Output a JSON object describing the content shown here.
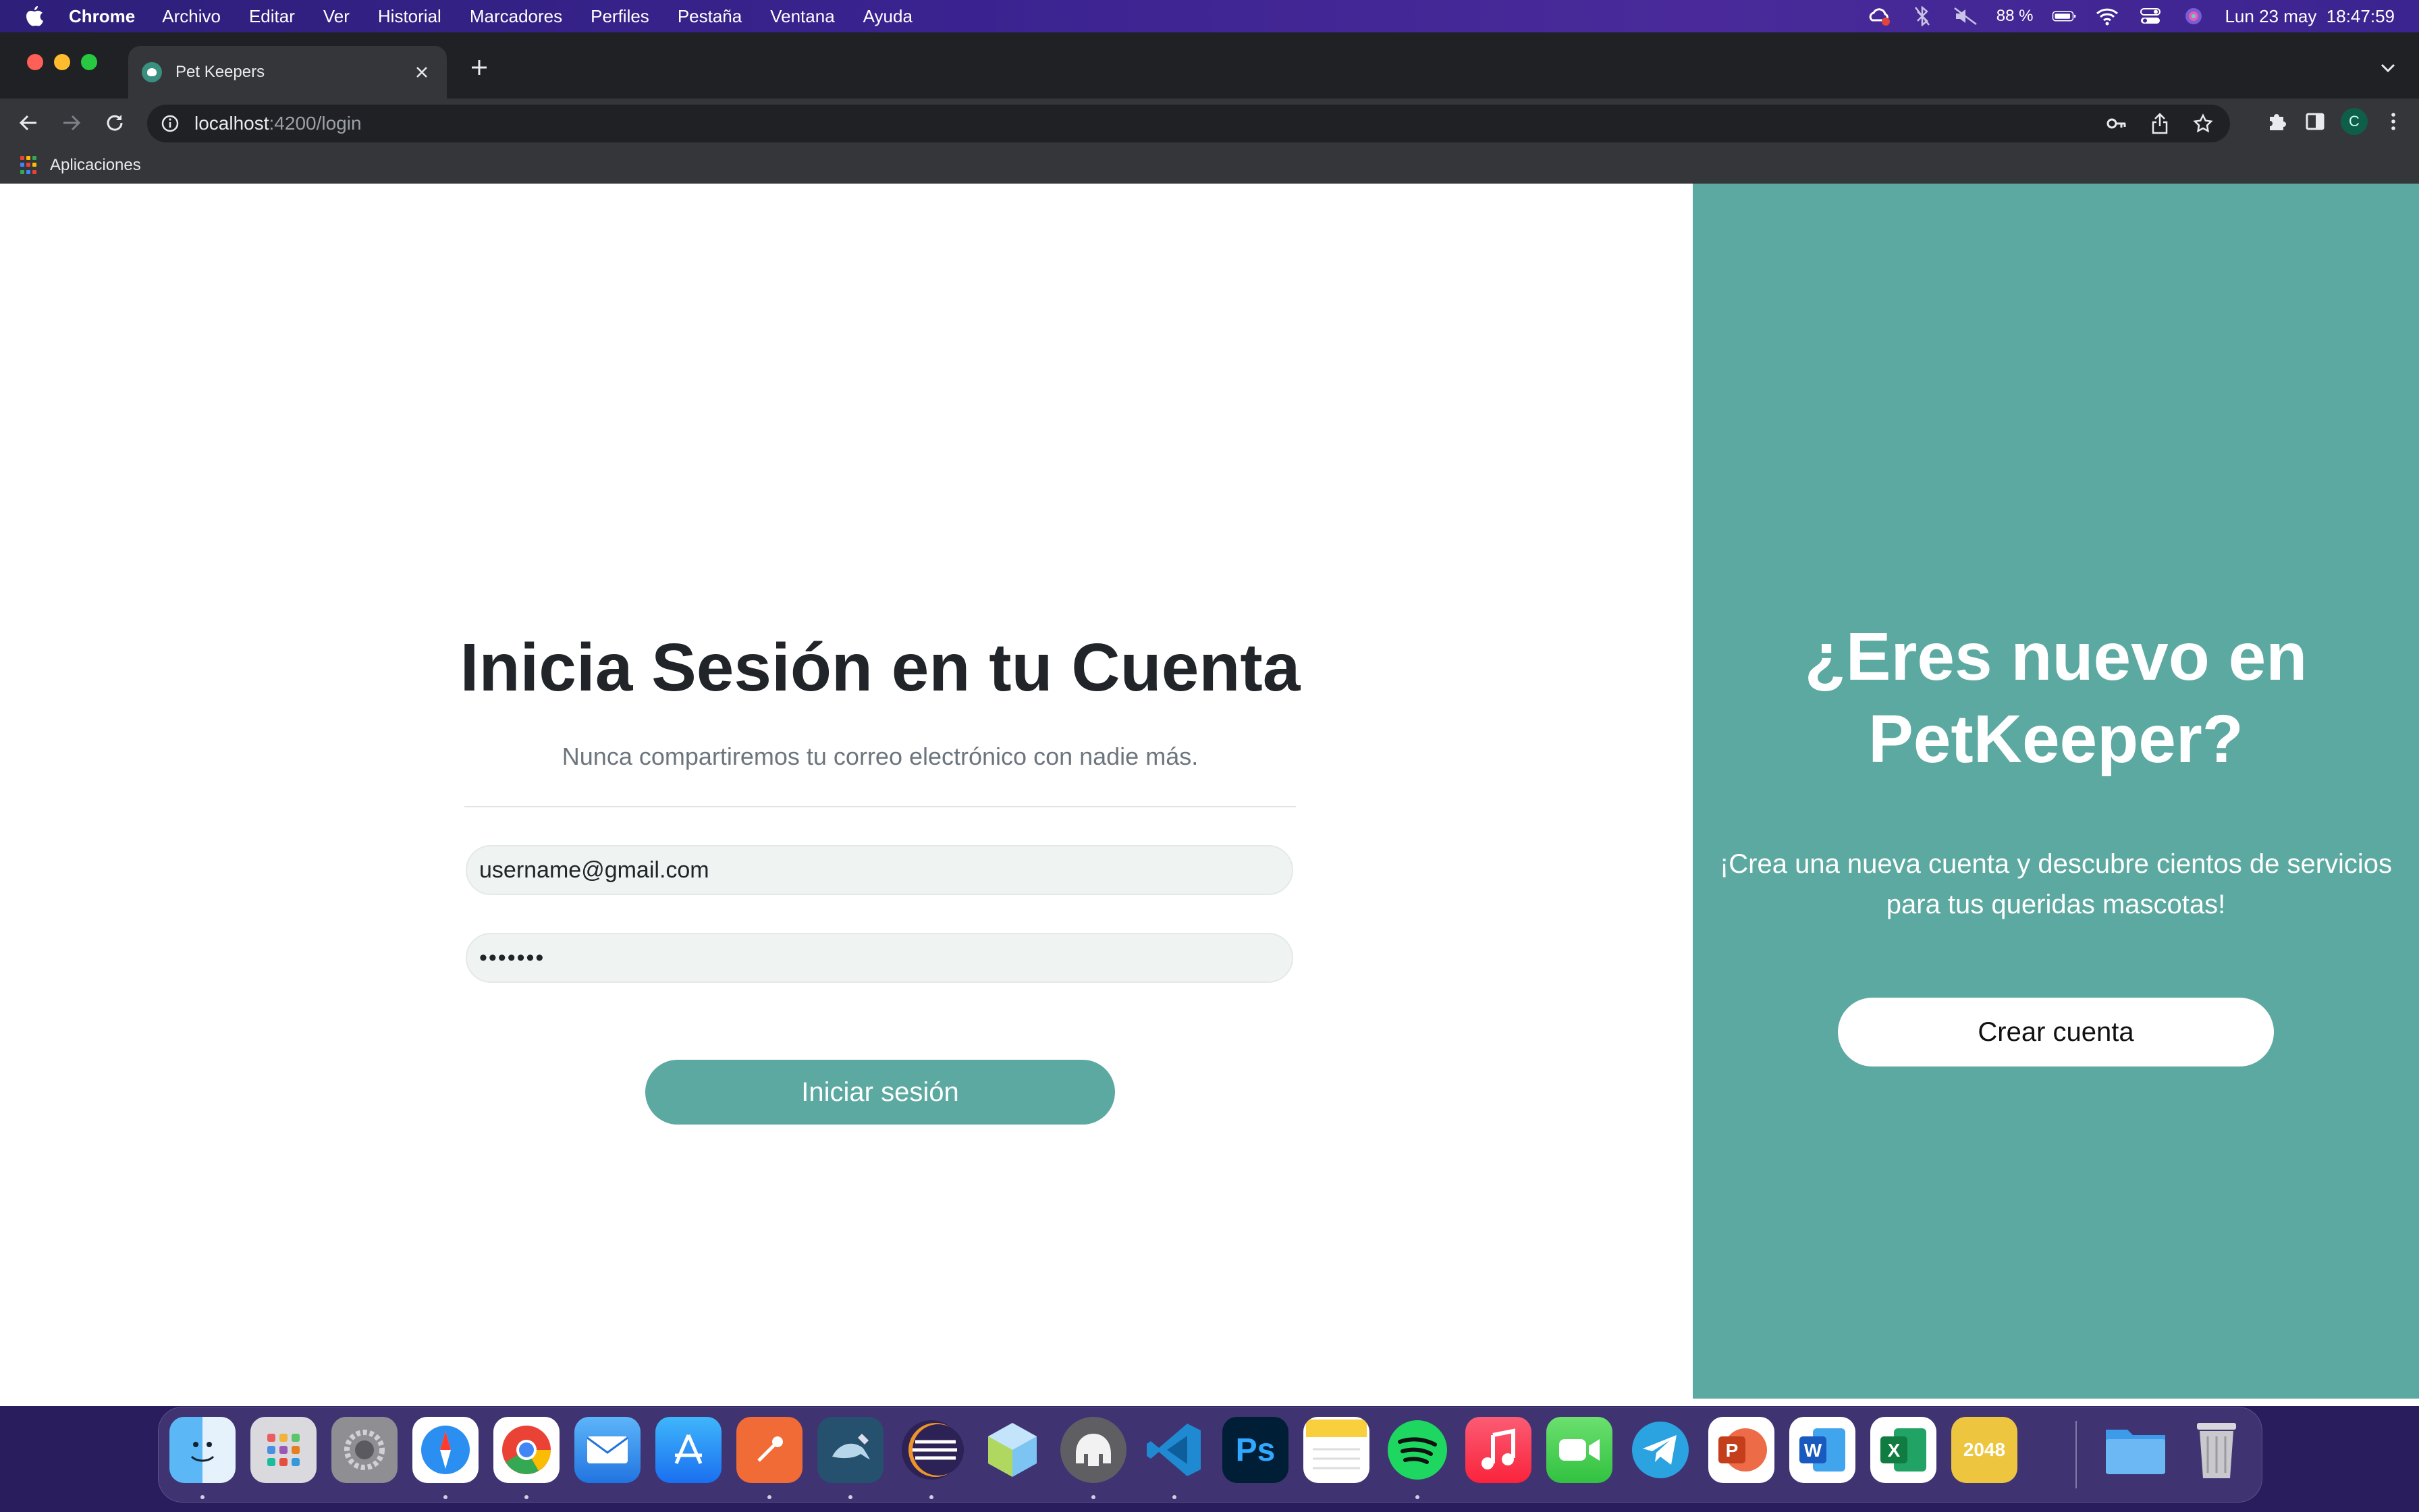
{
  "menubar": {
    "app_name": "Chrome",
    "items": [
      "Archivo",
      "Editar",
      "Ver",
      "Historial",
      "Marcadores",
      "Perfiles",
      "Pestaña",
      "Ventana",
      "Ayuda"
    ],
    "battery": "88 %",
    "datetime": "Lun 23 may  18:47:59"
  },
  "browser": {
    "tab_title": "Pet Keepers",
    "url_host": "localhost",
    "url_path": ":4200/login",
    "bookmark_apps": "Aplicaciones",
    "profile_initial": "C"
  },
  "login": {
    "title": "Inicia Sesión en tu Cuenta",
    "subtitle": "Nunca compartiremos tu correo electrónico con nadie más.",
    "email_value": "username@gmail.com",
    "password_value": "•••••••",
    "submit_label": "Iniciar sesión"
  },
  "signup": {
    "title": "¿Eres nuevo en PetKeeper?",
    "text": "¡Crea una nueva cuenta y descubre cientos de servicios para tus queridas mascotas!",
    "button_label": "Crear cuenta"
  },
  "dock": {
    "apps": [
      "finder",
      "launchpad",
      "system-preferences",
      "safari",
      "chrome",
      "mail",
      "app-store",
      "postman",
      "mysql-workbench",
      "eclipse",
      "virtualbox",
      "tableplus",
      "vscode",
      "photoshop",
      "notes",
      "spotify",
      "music",
      "facetime",
      "telegram",
      "powerpoint",
      "word",
      "excel",
      "2048",
      "downloads-folder",
      "trash"
    ],
    "game_label": "2048"
  },
  "colors": {
    "accent": "#5ba9a0",
    "title_text": "#212529",
    "muted_text": "#6c757d"
  }
}
